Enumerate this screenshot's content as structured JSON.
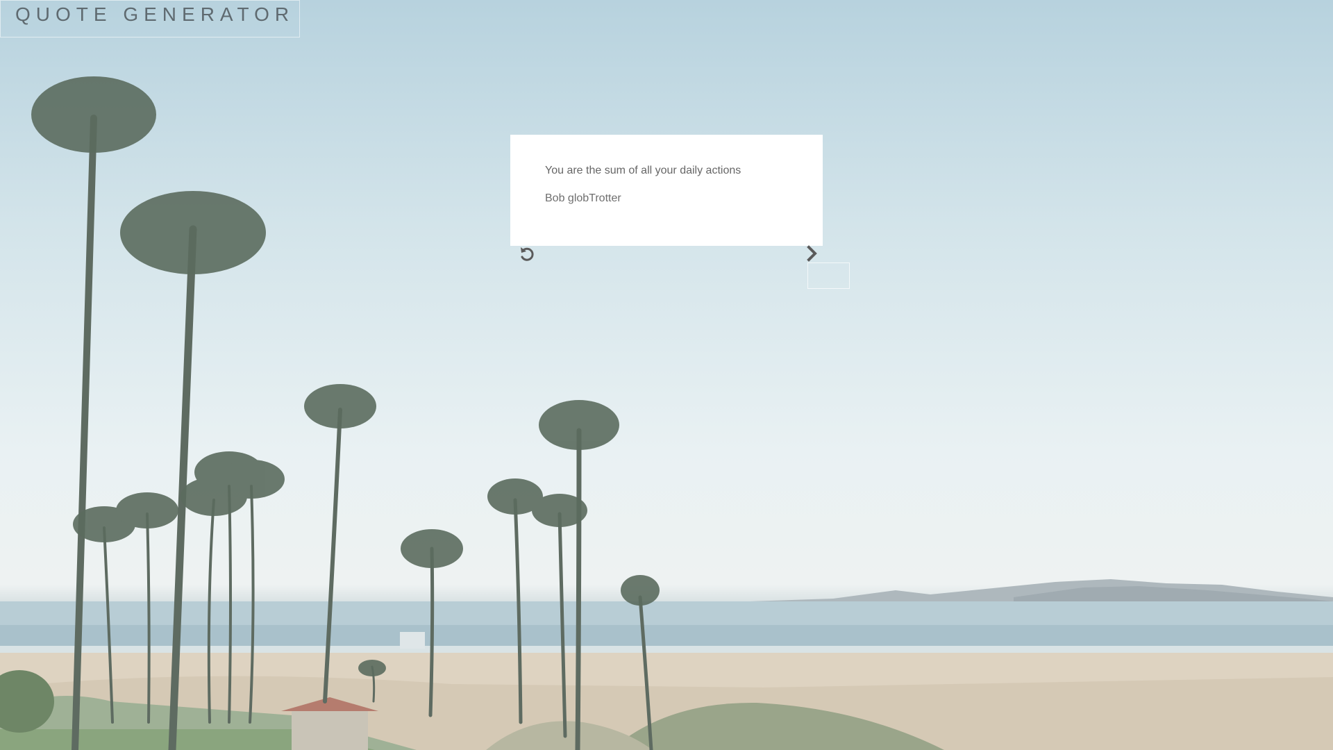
{
  "header": {
    "title": "QUOTE GENERATOR"
  },
  "quote": {
    "text": "You are the sum of all your daily actions",
    "author": "Bob globTrotter"
  },
  "controls": {
    "refresh_icon": "refresh-icon",
    "next_icon": "chevron-right-icon"
  },
  "colors": {
    "card_background": "#ffffff",
    "text": "#666666",
    "icon": "#5a5a5a"
  }
}
